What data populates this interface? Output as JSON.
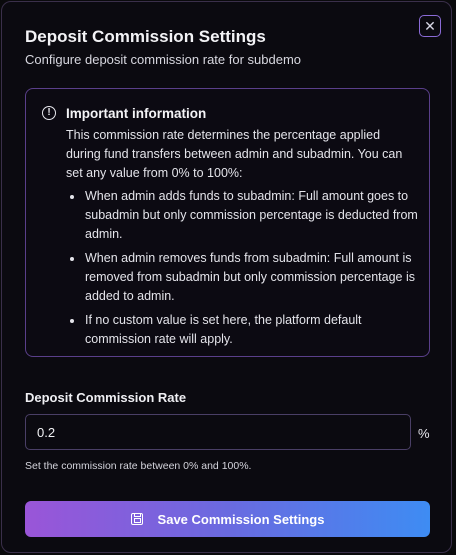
{
  "dialog": {
    "title": "Deposit Commission Settings",
    "subtitle": "Configure deposit commission rate for subdemo",
    "close_icon": "x-icon"
  },
  "info": {
    "icon": "info-icon",
    "heading": "Important information",
    "body": "This commission rate determines the percentage applied during fund transfers between admin and subadmin. You can set any value from 0% to 100%:",
    "items": [
      "When admin adds funds to subadmin: Full amount goes to subadmin but only commission percentage is deducted from admin.",
      "When admin removes funds from subadmin: Full amount is removed from subadmin but only commission percentage is added to admin.",
      "If no custom value is set here, the platform default commission rate will apply."
    ]
  },
  "rate": {
    "label": "Deposit Commission Rate",
    "value": "0.2",
    "unit": "%",
    "help": "Set the commission rate between 0% and 100%."
  },
  "actions": {
    "save_label": "Save Commission Settings",
    "save_icon": "save-icon"
  },
  "colors": {
    "background": "#0b0a10",
    "border_accent": "#5a3f8a",
    "button_gradient_start": "#9a55d8",
    "button_gradient_end": "#3e8cf3"
  }
}
